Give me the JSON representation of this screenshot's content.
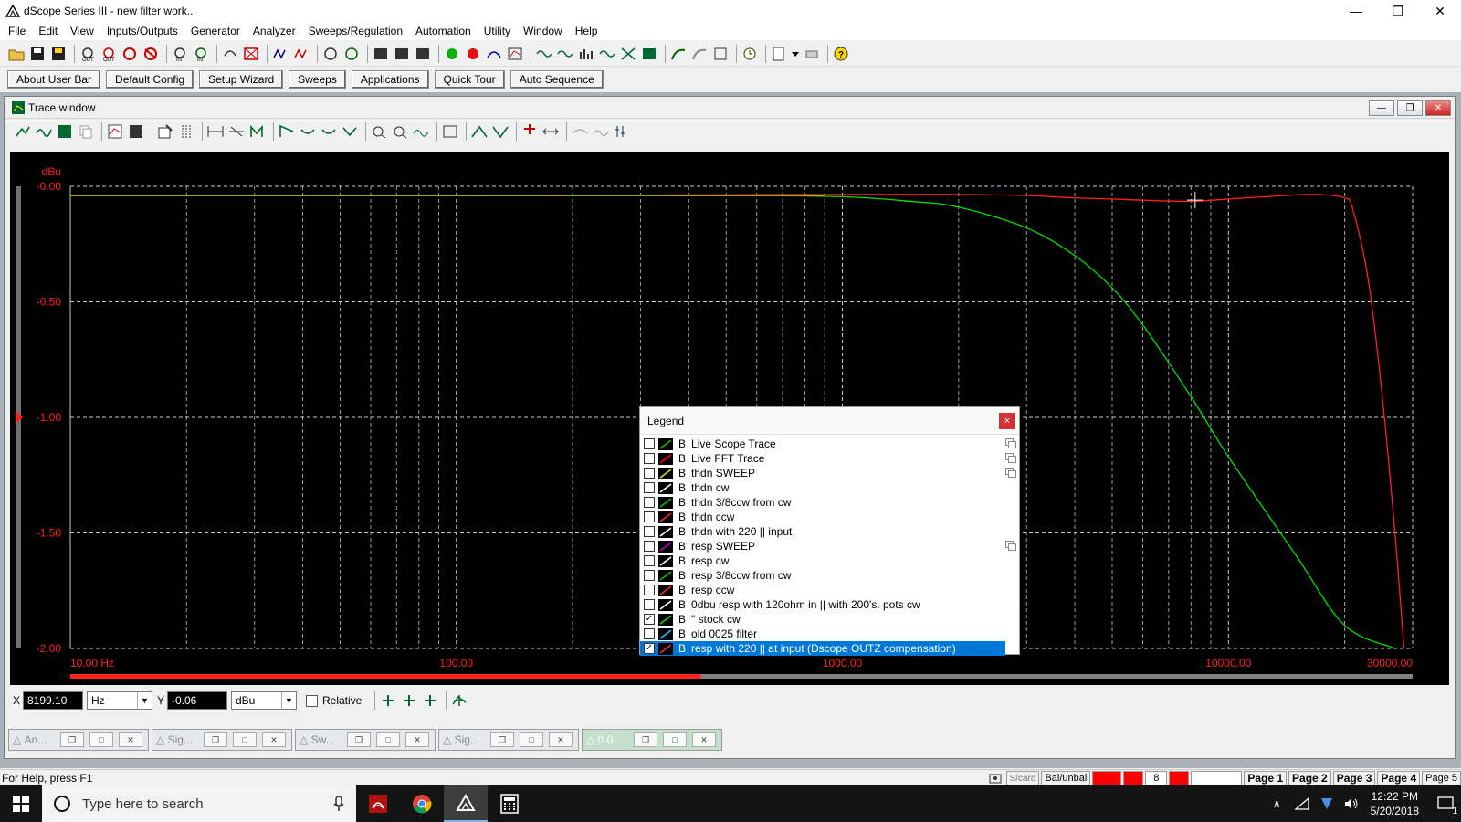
{
  "window": {
    "title": "dScope Series III - new filter work.."
  },
  "menu": [
    "File",
    "Edit",
    "View",
    "Inputs/Outputs",
    "Generator",
    "Analyzer",
    "Sweeps/Regulation",
    "Automation",
    "Utility",
    "Window",
    "Help"
  ],
  "user_bar": [
    "About User Bar",
    "Default Config",
    "Setup Wizard",
    "Sweeps",
    "Applications",
    "Quick Tour",
    "Auto Sequence"
  ],
  "trace_window": {
    "title": "Trace window"
  },
  "chart_data": {
    "type": "line",
    "ylabel": "dBu",
    "xscale": "log",
    "xlim": [
      10,
      30000
    ],
    "ylim": [
      -2.0,
      0.0
    ],
    "x_ticks": [
      {
        "value": 10,
        "label": "10.00 Hz"
      },
      {
        "value": 100,
        "label": "100.00"
      },
      {
        "value": 1000,
        "label": "1000.00"
      },
      {
        "value": 10000,
        "label": "10000.00"
      },
      {
        "value": 30000,
        "label": "30000.00"
      }
    ],
    "y_ticks": [
      {
        "value": 0.0,
        "label": "-0.00"
      },
      {
        "value": -0.5,
        "label": "-0.50"
      },
      {
        "value": -1.0,
        "label": "-1.00"
      },
      {
        "value": -1.5,
        "label": "-1.50"
      },
      {
        "value": -2.0,
        "label": "-2.00"
      }
    ],
    "grid": true,
    "background": "#000000",
    "series": [
      {
        "color": "#00e000",
        "x": [
          10,
          100,
          500,
          1000,
          1500,
          2000,
          3000,
          4000,
          5000,
          6000,
          8000,
          10000,
          15000,
          20000,
          27000
        ],
        "y": [
          -0.04,
          -0.04,
          -0.04,
          -0.045,
          -0.065,
          -0.09,
          -0.18,
          -0.3,
          -0.44,
          -0.6,
          -0.91,
          -1.17,
          -1.6,
          -1.9,
          -2.0
        ]
      },
      {
        "color": "#ff2020",
        "x": [
          10,
          100,
          1000,
          2000,
          3000,
          4000,
          5000,
          6000,
          8000,
          10000,
          14000,
          17000,
          20000,
          21000,
          23000,
          25000,
          27000,
          28500
        ],
        "y": [
          -0.04,
          -0.04,
          -0.035,
          -0.035,
          -0.04,
          -0.05,
          -0.055,
          -0.06,
          -0.065,
          -0.055,
          -0.04,
          -0.035,
          -0.05,
          -0.1,
          -0.4,
          -0.9,
          -1.5,
          -2.0
        ]
      }
    ],
    "cursor": {
      "x": 8199.1,
      "y": -0.06
    },
    "y_marker": -1.0
  },
  "readout": {
    "x_label": "X",
    "x_value": "8199.10",
    "x_unit": "Hz",
    "y_label": "Y",
    "y_value": "-0.06",
    "y_unit": "dBu",
    "relative_label": "Relative"
  },
  "minimized_windows": [
    {
      "label": "An..."
    },
    {
      "label": "Sig..."
    },
    {
      "label": "Sw..."
    },
    {
      "label": "Sig..."
    },
    {
      "label": "0.0..."
    }
  ],
  "legend": {
    "title": "Legend",
    "close": "×",
    "items": [
      {
        "checked": false,
        "channel": "B",
        "label": "Live Scope Trace",
        "color": "#00c000",
        "copy": true
      },
      {
        "checked": false,
        "channel": "B",
        "label": "Live FFT Trace",
        "color": "#ff0000",
        "copy": true
      },
      {
        "checked": false,
        "channel": "B",
        "label": "thdn SWEEP",
        "color": "#e0e000",
        "copy": true
      },
      {
        "checked": false,
        "channel": "B",
        "label": "thdn cw",
        "color": "#ffffff",
        "copy": false
      },
      {
        "checked": false,
        "channel": "B",
        "label": "thdn 3/8ccw from cw",
        "color": "#00c000",
        "copy": false
      },
      {
        "checked": false,
        "channel": "B",
        "label": "thdn ccw",
        "color": "#ff2020",
        "copy": false
      },
      {
        "checked": false,
        "channel": "B",
        "label": "thdn with 220 || input",
        "color": "#ffffff",
        "copy": false
      },
      {
        "checked": false,
        "channel": "B",
        "label": "resp SWEEP",
        "color": "#c000c0",
        "copy": true
      },
      {
        "checked": false,
        "channel": "B",
        "label": "resp cw",
        "color": "#ffffff",
        "copy": false
      },
      {
        "checked": false,
        "channel": "B",
        "label": "resp 3/8ccw from cw",
        "color": "#00c000",
        "copy": false
      },
      {
        "checked": false,
        "channel": "B",
        "label": "resp ccw",
        "color": "#ff2020",
        "copy": false
      },
      {
        "checked": false,
        "channel": "B",
        "label": "0dbu resp with 120ohm in || with 200's. pots cw",
        "color": "#ffffff",
        "copy": false
      },
      {
        "checked": true,
        "channel": "B",
        "label": "\" stock cw",
        "color": "#00e000",
        "copy": false
      },
      {
        "checked": false,
        "channel": "B",
        "label": "old 0025 filter",
        "color": "#20c0ff",
        "copy": false
      },
      {
        "checked": true,
        "channel": "B",
        "label": "resp with 220 || at input (Dscope OUTZ compensation)",
        "color": "#ff2020",
        "copy": false,
        "selected": true
      }
    ]
  },
  "status": {
    "help": "For Help, press F1",
    "scard": "S/card",
    "balunbal": "Bal/unbal",
    "count": "8",
    "pages": [
      "Page 1",
      "Page 2",
      "Page 3",
      "Page 4",
      "Page 5"
    ]
  },
  "taskbar": {
    "search_placeholder": "Type here to search",
    "time": "12:22 PM",
    "date": "5/20/2018",
    "notifications": "1"
  }
}
